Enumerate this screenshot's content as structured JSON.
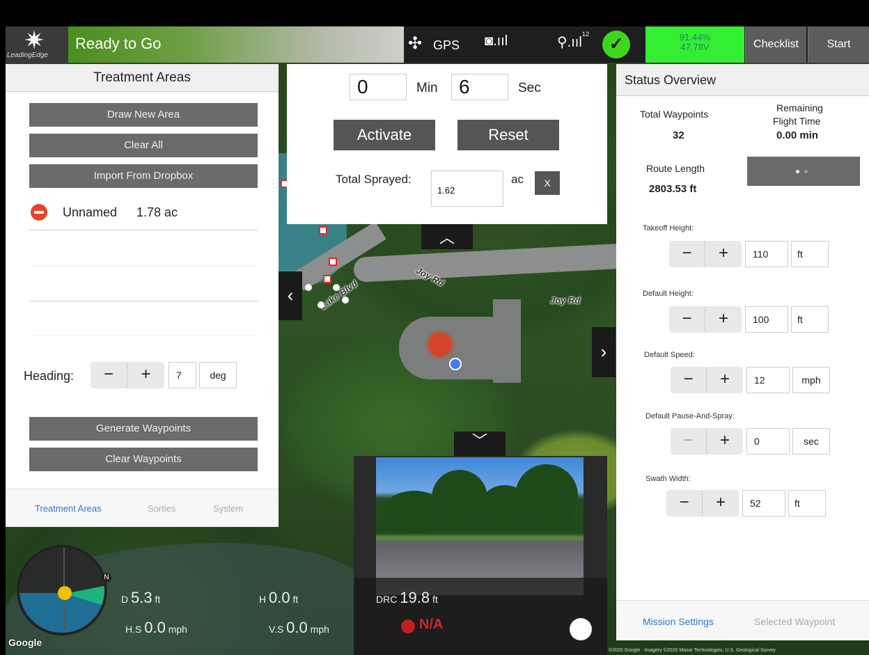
{
  "topbar": {
    "status": "Ready to Go",
    "logo_text": "LeadingEdge",
    "gps_label": "GPS",
    "satellite_count": "12",
    "battery_percent": "91.44%",
    "battery_voltage": "47.78V",
    "checklist_label": "Checklist",
    "start_label": "Start"
  },
  "left_panel": {
    "title": "Treatment Areas",
    "draw_new_area": "Draw New Area",
    "clear_all": "Clear All",
    "import_dropbox": "Import From Dropbox",
    "areas": [
      {
        "name": "Unnamed",
        "size": "1.78 ac"
      }
    ],
    "heading_label": "Heading:",
    "heading_value": "7",
    "heading_unit": "deg",
    "generate_waypoints": "Generate Waypoints",
    "clear_waypoints": "Clear Waypoints",
    "tabs": [
      "Treatment Areas",
      "Sorties",
      "System"
    ]
  },
  "timer": {
    "min_value": "0",
    "min_label": "Min",
    "sec_value": "6",
    "sec_label": "Sec",
    "activate": "Activate",
    "reset": "Reset",
    "total_sprayed_label": "Total Sprayed:",
    "total_sprayed_value": "1.62",
    "unit": "ac",
    "clear": "X"
  },
  "status_overview": {
    "title": "Status Overview",
    "total_waypoints_label": "Total Waypoints",
    "total_waypoints": "32",
    "remaining_label_1": "Remaining",
    "remaining_label_2": "Flight Time",
    "remaining_value": "0.00 min",
    "route_length_label": "Route Length",
    "route_length": "2803.53 ft",
    "settings": [
      {
        "label": "Takeoff Height:",
        "value": "110",
        "unit": "ft"
      },
      {
        "label": "Default Height:",
        "value": "100",
        "unit": "ft"
      },
      {
        "label": "Default Speed:",
        "value": "12",
        "unit": "mph"
      },
      {
        "label": "Default Pause-And-Spray:",
        "value": "0",
        "unit": "sec"
      },
      {
        "label": "Swath Width:",
        "value": "52",
        "unit": "ft"
      }
    ],
    "tabs": [
      "Mission Settings",
      "Selected Waypoint"
    ]
  },
  "map": {
    "road_labels": [
      "Joy Rd",
      "Joy Rd",
      "Lake Blvd"
    ],
    "google": "Google",
    "attribution": "©2020 Google · Imagery ©2020 Maxar Technologies, U.S. Geological Survey"
  },
  "telemetry": {
    "d_label": "D",
    "d_value": "5.3",
    "d_unit": "ft",
    "h_label": "H",
    "h_value": "0.0",
    "h_unit": "ft",
    "hs_label": "H.S",
    "hs_value": "0.0",
    "hs_unit": "mph",
    "vs_label": "V.S",
    "vs_value": "0.0",
    "vs_unit": "mph",
    "drc_label": "DRC",
    "drc_value": "19.8",
    "drc_unit": "ft",
    "na": "N/A",
    "compass_n": "N"
  },
  "colors": {
    "status_green": "#4a8f1e",
    "battery_green": "#33ee33",
    "check_green": "#3dd61c",
    "link_blue": "#2f79c8"
  }
}
